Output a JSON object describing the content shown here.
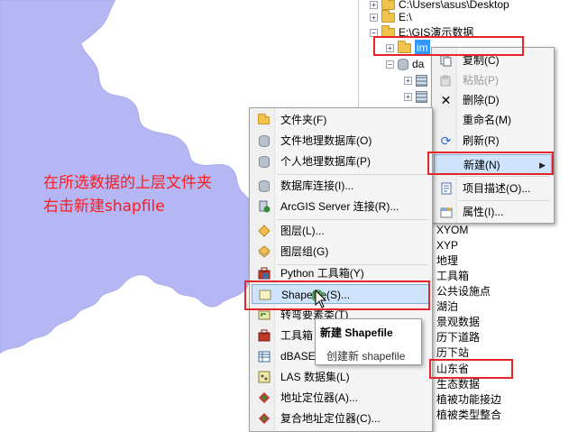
{
  "annotation": {
    "line1": "在所选数据的上层文件夹",
    "line2": "右击新建shapfile"
  },
  "tree": {
    "rows": [
      {
        "label": "C:\\Users\\asus\\Desktop",
        "icon": "folder-icon"
      },
      {
        "label": "E:\\",
        "icon": "folder-icon"
      },
      {
        "label": "E:\\GIS演示数据",
        "icon": "folder-icon"
      },
      {
        "label": "im",
        "icon": "folder-icon",
        "selected": true
      },
      {
        "label": "da",
        "icon": "database-icon"
      }
    ],
    "list_items": [
      "XYOM",
      "XYP",
      "地理",
      "工具箱",
      "公共设施点",
      "湖泊",
      "景观数据",
      "历下道路",
      "历下站",
      "山东省",
      "生态数据",
      "植被功能接边",
      "植被类型整合"
    ]
  },
  "context_menu": {
    "items": [
      {
        "label": "复制(C)",
        "icon": "copy-icon",
        "disabled": false
      },
      {
        "label": "粘贴(P)",
        "icon": "paste-icon",
        "disabled": true
      },
      {
        "label": "删除(D)",
        "icon": "delete-icon",
        "disabled": false
      },
      {
        "label": "重命名(M)",
        "icon": "",
        "disabled": false
      },
      {
        "label": "刷新(R)",
        "icon": "refresh-icon",
        "disabled": false
      },
      {
        "label": "新建(N)",
        "icon": "",
        "disabled": false,
        "submenu": true
      },
      {
        "label": "项目描述(O)...",
        "icon": "document-icon",
        "disabled": false
      },
      {
        "label": "属性(I)...",
        "icon": "properties-icon",
        "disabled": false
      }
    ]
  },
  "new_submenu": {
    "items": [
      {
        "label": "文件夹(F)",
        "icon": "folder-icon"
      },
      {
        "label": "文件地理数据库(O)",
        "icon": "file-geodatabase-icon"
      },
      {
        "label": "个人地理数据库(P)",
        "icon": "personal-geodatabase-icon"
      },
      {
        "label": "数据库连接(I)...",
        "icon": "database-connection-icon"
      },
      {
        "label": "ArcGIS Server 连接(R)...",
        "icon": "arcgis-server-icon"
      },
      {
        "label": "图层(L)...",
        "icon": "layer-icon"
      },
      {
        "label": "图层组(G)",
        "icon": "layer-group-icon"
      },
      {
        "label": "Python 工具箱(Y)",
        "icon": "python-toolbox-icon"
      },
      {
        "label": "Shapefile(S)...",
        "icon": "shapefile-icon"
      },
      {
        "label": "转弯要素类(T)",
        "icon": "turn-feature-class-icon"
      },
      {
        "label": "工具箱",
        "icon": "toolbox-icon"
      },
      {
        "label": "dBASE",
        "icon": "dbase-table-icon"
      },
      {
        "label": "LAS 数据集(L)",
        "icon": "las-dataset-icon"
      },
      {
        "label": "地址定位器(A)...",
        "icon": "address-locator-icon"
      },
      {
        "label": "复合地址定位器(C)...",
        "icon": "composite-locator-icon"
      }
    ]
  },
  "tooltip": {
    "title": "新建 Shapefile",
    "description": "创建新 shapefile"
  },
  "colors": {
    "map_fill": "#b4b7f4",
    "highlight": "#cfe4fb",
    "annotation": "#ff1a1a",
    "red_box": "#e4262b"
  }
}
